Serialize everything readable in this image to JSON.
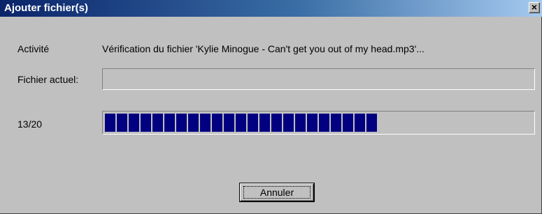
{
  "window": {
    "title": "Ajouter fichier(s)",
    "close_glyph": "×"
  },
  "activity": {
    "label": "Activité",
    "text": "Vérification du fichier 'Kylie Minogue - Can't get you out of my head.mp3'..."
  },
  "current_file": {
    "label": "Fichier actuel:",
    "value": ""
  },
  "progress": {
    "label": "13/20",
    "fraction": 0.65,
    "color": "#000080"
  },
  "actions": {
    "cancel_label": "Annuler"
  },
  "icons": {
    "close": "close-icon"
  }
}
